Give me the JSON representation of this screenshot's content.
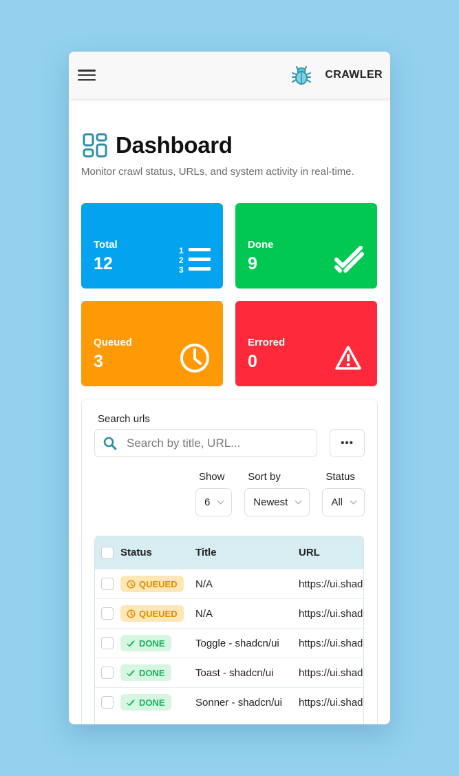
{
  "app": {
    "brand": "CRAWLER"
  },
  "page": {
    "title": "Dashboard",
    "subtitle": "Monitor crawl status, URLs, and system activity in real-time."
  },
  "stats": [
    {
      "label": "Total",
      "value": "12",
      "color": "#04a3f0",
      "icon": "numbered-list-icon"
    },
    {
      "label": "Done",
      "value": "9",
      "color": "#00c853",
      "icon": "double-check-icon"
    },
    {
      "label": "Queued",
      "value": "3",
      "color": "#fe9a06",
      "icon": "clock-icon"
    },
    {
      "label": "Errored",
      "value": "0",
      "color": "#fe2a3b",
      "icon": "warning-icon"
    }
  ],
  "search": {
    "label": "Search urls",
    "placeholder": "Search by title, URL...",
    "more_label": "•••"
  },
  "filters": {
    "show": {
      "label": "Show",
      "value": "6"
    },
    "sort": {
      "label": "Sort by",
      "value": "Newest"
    },
    "status": {
      "label": "Status",
      "value": "All"
    }
  },
  "table": {
    "headers": {
      "status": "Status",
      "title": "Title",
      "url": "URL"
    },
    "rows": [
      {
        "status": "QUEUED",
        "title": "N/A",
        "url": "https://ui.shadcn.com"
      },
      {
        "status": "QUEUED",
        "title": "N/A",
        "url": "https://ui.shadcn.com"
      },
      {
        "status": "DONE",
        "title": "Toggle - shadcn/ui",
        "url": "https://ui.shadcn.com"
      },
      {
        "status": "DONE",
        "title": "Toast - shadcn/ui",
        "url": "https://ui.shadcn.com"
      },
      {
        "status": "DONE",
        "title": "Sonner - shadcn/ui",
        "url": "https://ui.shadcn.com"
      }
    ]
  }
}
